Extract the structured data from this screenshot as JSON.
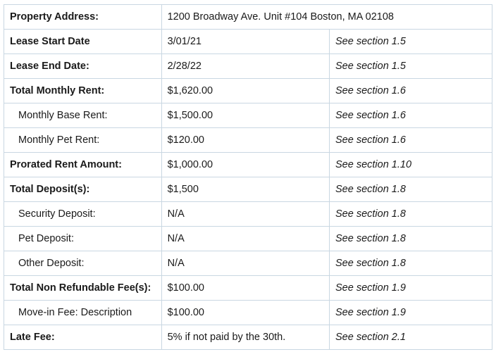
{
  "lease_summary": {
    "rows": [
      {
        "label": "Property Address:",
        "value": "1200 Broadway Ave. Unit #104  Boston, MA  02108",
        "ref": "",
        "style": "bold",
        "merged": true
      },
      {
        "label": "Lease Start Date",
        "value": "3/01/21",
        "ref": "See section 1.5",
        "style": "bold"
      },
      {
        "label": "Lease End Date:",
        "value": "2/28/22",
        "ref": "See section 1.5",
        "style": "bold"
      },
      {
        "label": "Total Monthly Rent:",
        "value": "$1,620.00",
        "ref": "See section 1.6",
        "style": "bold"
      },
      {
        "label": "Monthly Base Rent:",
        "value": "$1,500.00",
        "ref": "See section 1.6",
        "style": "sub"
      },
      {
        "label": "Monthly Pet Rent:",
        "value": "$120.00",
        "ref": "See section 1.6",
        "style": "sub"
      },
      {
        "label": "Prorated Rent Amount:",
        "value": "$1,000.00",
        "ref": "See section 1.10",
        "style": "bold"
      },
      {
        "label": "Total Deposit(s):",
        "value": "$1,500",
        "ref": "See section 1.8",
        "style": "bold"
      },
      {
        "label": "Security Deposit:",
        "value": "N/A",
        "ref": "See section 1.8",
        "style": "sub"
      },
      {
        "label": "Pet Deposit:",
        "value": "N/A",
        "ref": "See section 1.8",
        "style": "sub"
      },
      {
        "label": "Other Deposit:",
        "value": "N/A",
        "ref": "See section 1.8",
        "style": "sub"
      },
      {
        "label": "Total Non Refundable Fee(s):",
        "value": "$100.00",
        "ref": "See section 1.9",
        "style": "bold"
      },
      {
        "label": "Move-in Fee: Description",
        "value": "$100.00",
        "ref": "See section 1.9",
        "style": "sub"
      },
      {
        "label": "Late Fee:",
        "value": "5% if not paid by the 30th.",
        "ref": "See section 2.1",
        "style": "bold"
      }
    ]
  }
}
